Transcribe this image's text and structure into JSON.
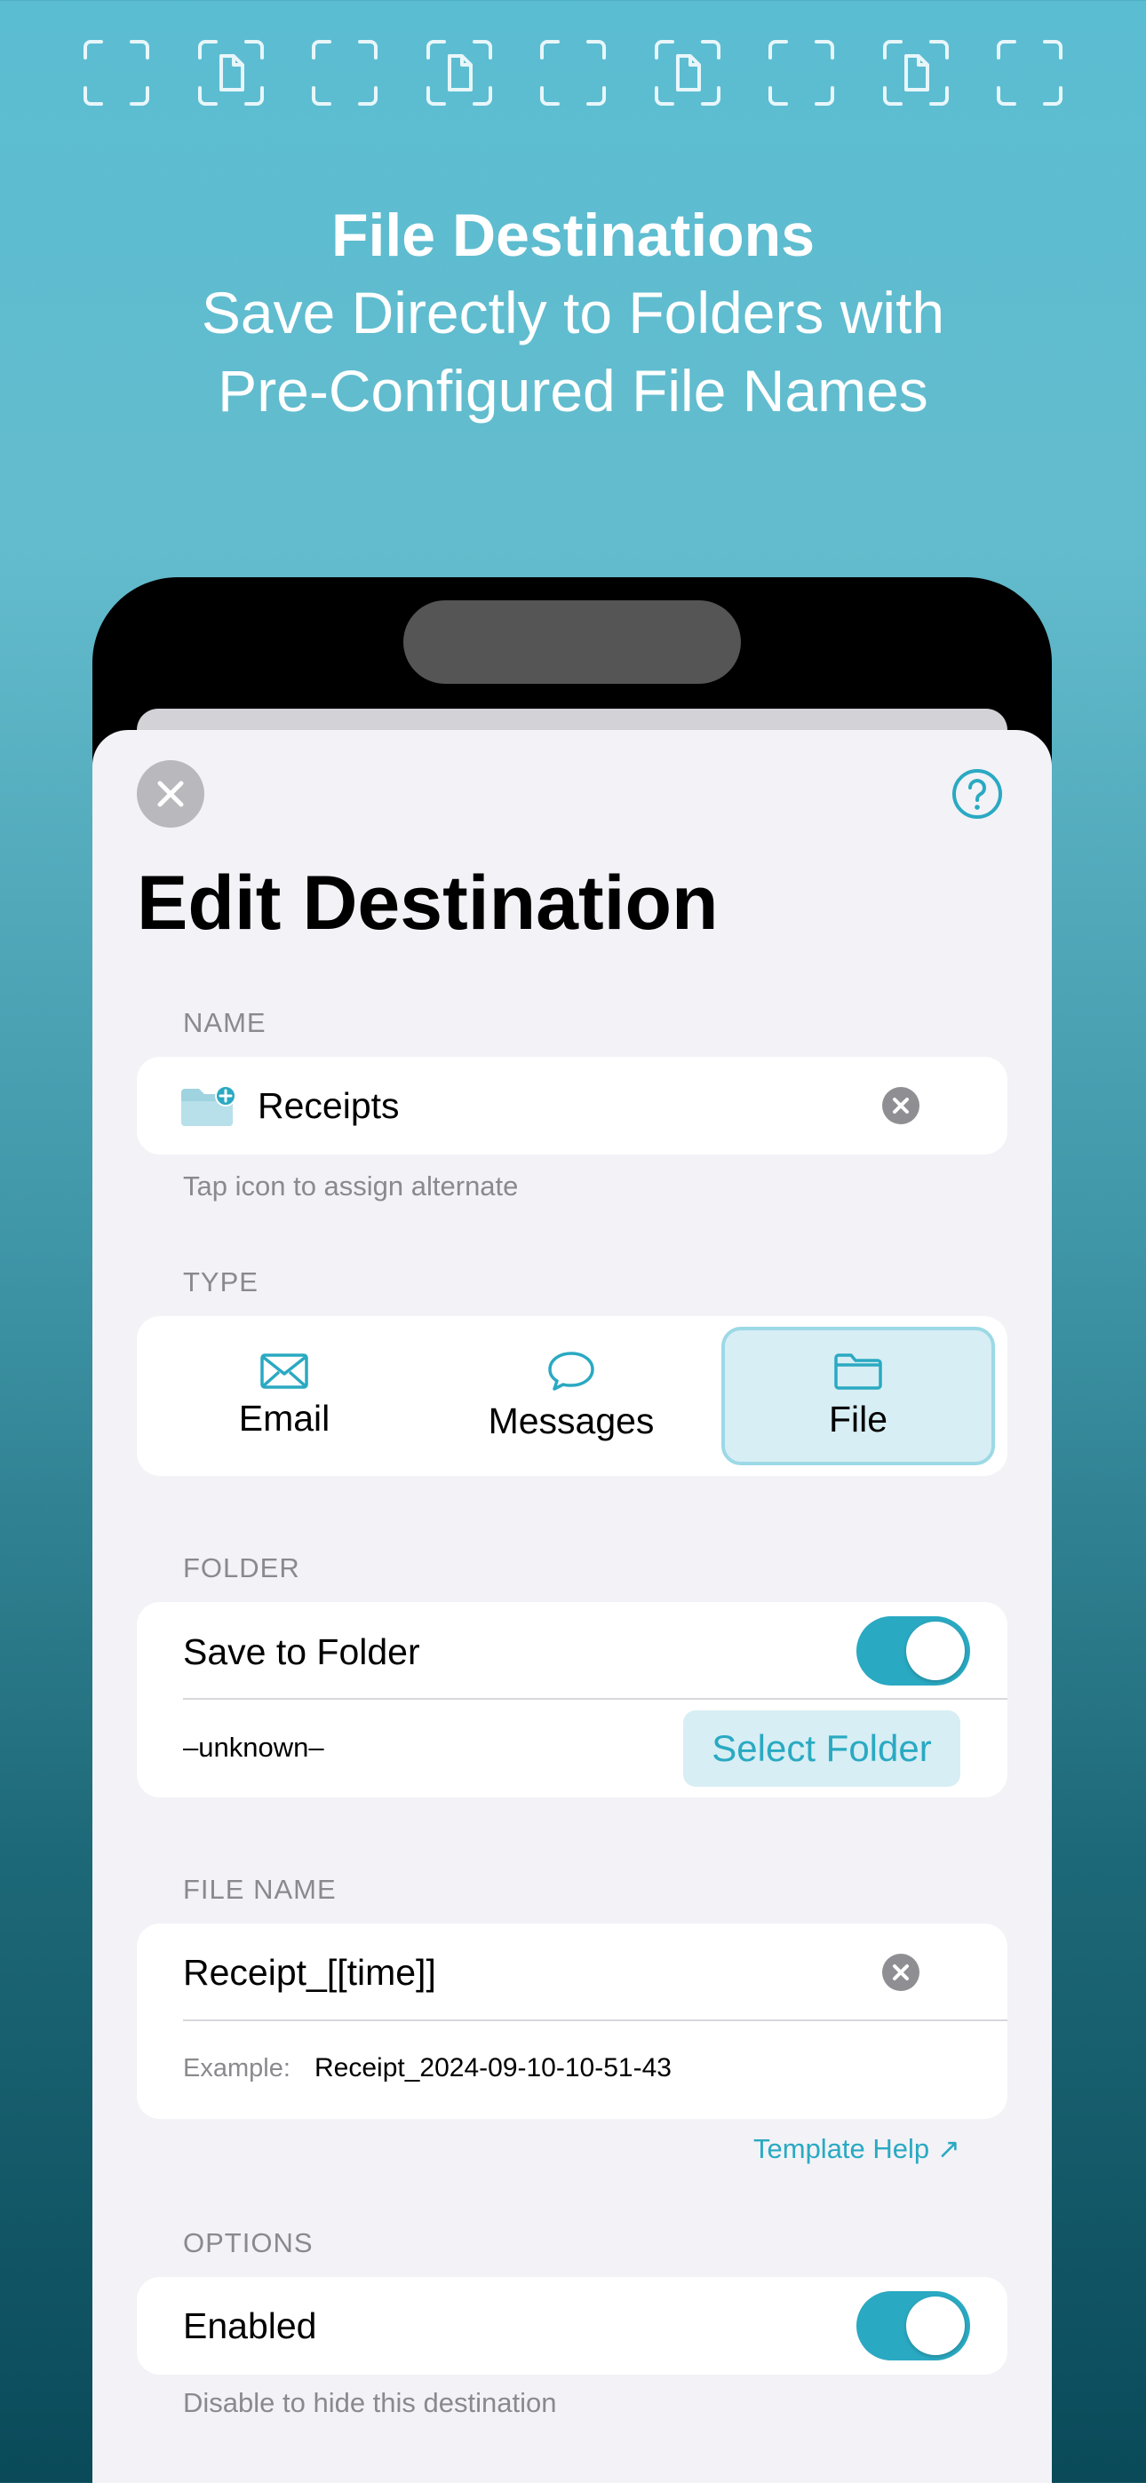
{
  "banner": {
    "title": "File Destinations",
    "subtitle_line1": "Save Directly to Folders with",
    "subtitle_line2": "Pre-Configured File Names"
  },
  "sheet": {
    "title": "Edit Destination",
    "close_icon": "close-icon",
    "help_icon": "help-icon"
  },
  "name_section": {
    "label": "NAME",
    "value": "Receipts",
    "icon": "folder-plus-icon",
    "footnote": "Tap icon to assign alternate"
  },
  "type_section": {
    "label": "TYPE",
    "options": [
      {
        "label": "Email",
        "icon": "envelope-icon",
        "selected": false
      },
      {
        "label": "Messages",
        "icon": "chat-bubble-icon",
        "selected": false
      },
      {
        "label": "File",
        "icon": "folder-icon",
        "selected": true
      }
    ]
  },
  "folder_section": {
    "label": "FOLDER",
    "save_to_folder_label": "Save to Folder",
    "save_to_folder_on": true,
    "folder_value": "–unknown–",
    "select_button": "Select Folder"
  },
  "file_name_section": {
    "label": "FILE NAME",
    "value": "Receipt_[[time]]",
    "example_label": "Example:",
    "example_value": "Receipt_2024-09-10-10-51-43",
    "template_help": "Template Help ↗"
  },
  "options_section": {
    "label": "OPTIONS",
    "enabled_label": "Enabled",
    "enabled_on": true,
    "footnote": "Disable to hide this destination"
  },
  "colors": {
    "accent": "#2aa9c2",
    "sheet_bg": "#f2f2f7"
  }
}
